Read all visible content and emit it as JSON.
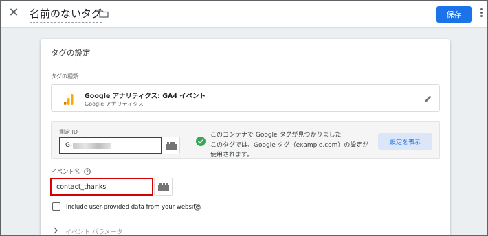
{
  "header": {
    "title": "名前のないタグ",
    "save_label": "保存"
  },
  "card": {
    "title": "タグの設定",
    "tag_type_label": "タグの種類",
    "tag_type": {
      "name": "Google アナリティクス: GA4 イベント",
      "subtitle": "Google アナリティクス"
    },
    "measurement": {
      "label": "測定 ID",
      "value": "G-",
      "message_line1": "このコンテナで Google タグが見つかりました",
      "message_line2": "このタグでは、Google タグ（example.com）の設定が",
      "message_line3": "使用されます。",
      "settings_button": "設定を表示"
    },
    "event": {
      "label": "イベント名",
      "value": "contact_thanks"
    },
    "checkbox_label": "Include user-provided data from your website",
    "params_label": "イベント パラメータ"
  },
  "colors": {
    "accent": "#1a73e8",
    "highlight": "#d50000",
    "success": "#34a853"
  }
}
